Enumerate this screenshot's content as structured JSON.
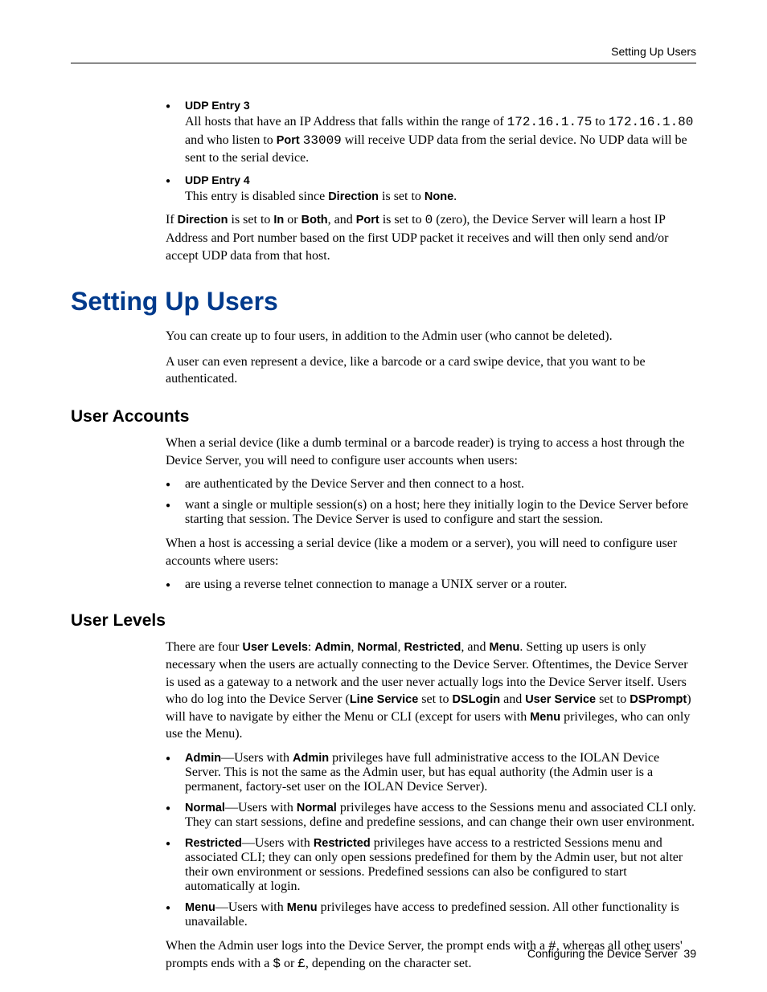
{
  "header": {
    "running": "Setting Up Users"
  },
  "udp3": {
    "title": "UDP Entry 3",
    "b1a": "All hosts that have an IP Address that falls within the range of ",
    "ip1": "172.16.1.75",
    "b1b": " to ",
    "ip2": "172.16.1.80",
    "b1c": " and who listen to ",
    "portLabel": "Port",
    "portNum": "33009",
    "b1d": " will receive UDP data from the serial device. No UDP data will be sent to the serial device."
  },
  "udp4": {
    "title": "UDP Entry 4",
    "b1a": "This entry is disabled since ",
    "dir": "Direction",
    "b1b": " is set to ",
    "none": "None",
    "b1c": "."
  },
  "ifpara": {
    "a": "If ",
    "dir": "Direction",
    "b": " is set to ",
    "in": "In",
    "c": " or ",
    "both": "Both",
    "d": ", and ",
    "port": "Port",
    "e": " is set to ",
    "zero": "0",
    "f": " (zero), the Device Server will learn a host IP Address and Port number based on the first UDP packet it receives and will then only send and/or accept UDP data from that host."
  },
  "h1": "Setting Up Users",
  "intro1": "You can create up to four users, in addition to the Admin user (who cannot be deleted).",
  "intro2": "A user can even represent a device, like a barcode or a card swipe device, that you want to be authenticated.",
  "h2a": "User Accounts",
  "ua_p1": "When a serial device (like a dumb terminal or a barcode reader) is trying to access a host through the Device Server, you will need to configure user accounts when users:",
  "ua_b1": "are authenticated by the Device Server and then connect to a host.",
  "ua_b2": "want a single or multiple session(s) on a host; here they initially login to the Device Server before starting that session. The Device Server is used to configure and start the session.",
  "ua_p2": "When a host is accessing a serial device (like a modem or a server), you will need to configure user accounts where users:",
  "ua_b3": "are using a reverse telnet connection to manage a UNIX server or a router.",
  "h2b": "User Levels",
  "ul_p1": {
    "a": "There are four ",
    "ulv": "User Levels",
    "b": ": ",
    "admin": "Admin",
    "c": ", ",
    "normal": "Normal",
    "d": ", ",
    "restricted": "Restricted",
    "e": ", and ",
    "menu": "Menu",
    "f": ". Setting up users is only necessary when the users are actually connecting to the Device Server. Oftentimes, the Device Server is used as a gateway to a network and the user never actually logs into the Device Server itself. Users who do log into the Device Server (",
    "ls": "Line Service",
    "g": " set to ",
    "dsl": "DSLogin",
    "h": " and ",
    "us": "User Service",
    "i": " set to ",
    "dsp": "DSPrompt",
    "j": ") will have to navigate by either the Menu or CLI (except for users with ",
    "menu2": "Menu",
    "k": " privileges, who can only use the Menu)."
  },
  "lvl": {
    "adminT": "Admin",
    "adminA": "—Users with ",
    "adminB": " privileges have full administrative access to the IOLAN Device Server. This is not the same as the Admin user, but has equal authority (the Admin user is a permanent, factory-set user on the IOLAN Device Server).",
    "normalT": "Normal",
    "normalA": "—Users with ",
    "normalB": " privileges have access to the Sessions menu and associated CLI only. They can start sessions, define and predefine sessions, and can change their own user environment.",
    "restrictedT": "Restricted",
    "restrictedA": "—Users with ",
    "restrictedB": " privileges have access to a restricted Sessions menu and associated CLI; they can only open sessions predefined for them by the Admin user, but not alter their own environment or sessions. Predefined sessions can also be configured to start automatically at login.",
    "menuT": "Menu",
    "menuA": "—Users with ",
    "menuB": " privileges have access to predefined session. All other functionality is unavailable."
  },
  "ul_p2": {
    "a": "When the Admin user logs into the Device Server, the prompt ends with a ",
    "hash": "#",
    "b": ", whereas all other users' prompts ends with a ",
    "dollar": "$",
    "c": " or ",
    "pound": "£",
    "d": ", depending on the character set."
  },
  "footer": {
    "label": "Configuring the Device Server",
    "page": "39"
  }
}
